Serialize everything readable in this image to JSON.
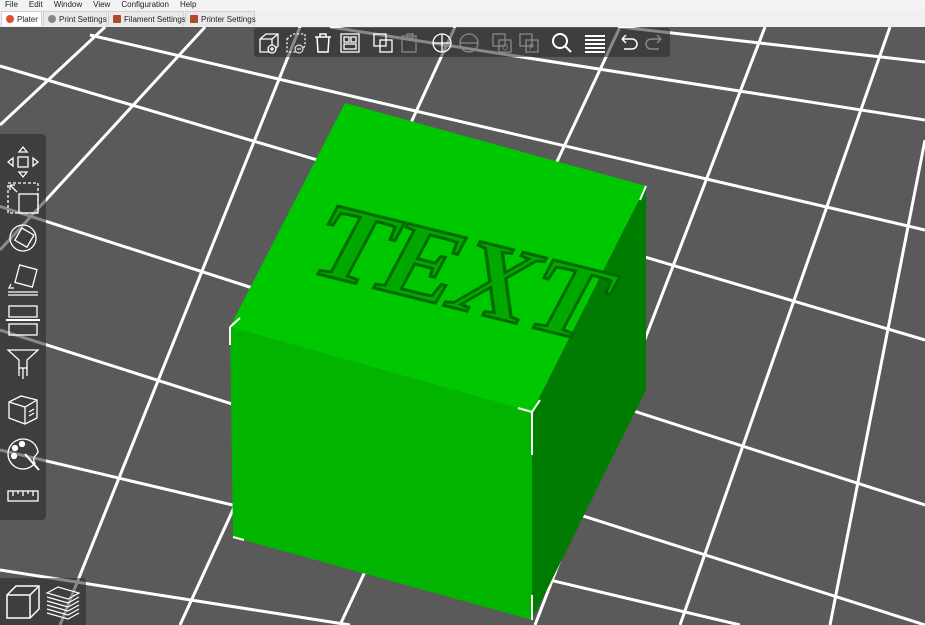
{
  "menu": {
    "file": "File",
    "edit": "Edit",
    "window": "Window",
    "view": "View",
    "configuration": "Configuration",
    "help": "Help"
  },
  "tabs": [
    {
      "label": "Plater",
      "icon": "plater-icon",
      "color": "#d9552b"
    },
    {
      "label": "Print Settings",
      "icon": "gear-icon",
      "color": "#888888"
    },
    {
      "label": "Filament Settings",
      "icon": "spool-icon",
      "color": "#b04a2a"
    },
    {
      "label": "Printer Settings",
      "icon": "printer-icon",
      "color": "#b04a2a"
    }
  ],
  "model": {
    "label": "TEXT",
    "color": "#00c800",
    "shade": "#007d00",
    "bed_color": "#5a5a5a",
    "grid_color": "#ffffff"
  },
  "toolbar_icons": [
    "add-icon",
    "delete-icon",
    "delete-all-icon",
    "arrange-icon",
    "copy-icon",
    "paste-icon",
    "add-instance-icon",
    "remove-instance-icon",
    "split-objects-icon",
    "split-parts-icon",
    "search-icon",
    "layers-editing-icon",
    "undo-icon",
    "redo-icon"
  ],
  "gizmo_icons": [
    "move-icon",
    "scale-icon",
    "rotate-icon",
    "place-on-face-icon",
    "cut-icon",
    "paint-supports-icon",
    "fdm-supports-icon",
    "seam-painting-icon",
    "measure-icon"
  ]
}
